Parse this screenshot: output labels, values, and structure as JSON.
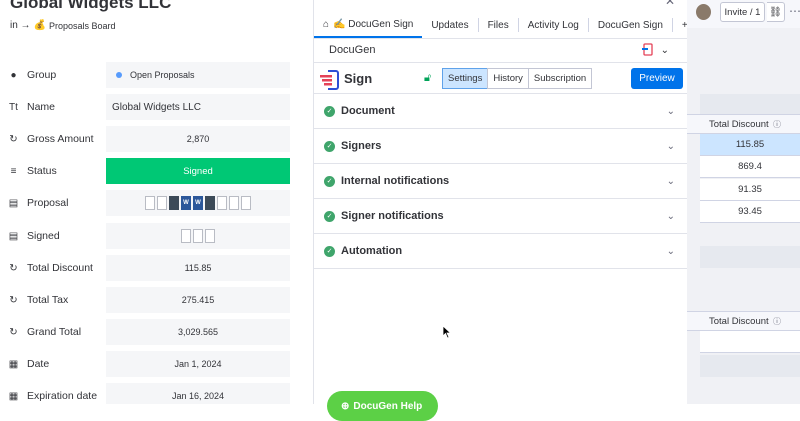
{
  "item": {
    "title": "Global Widgets LLC",
    "breadcrumb_prefix": "in →",
    "board_emoji": "💰",
    "board_name": "Proposals Board"
  },
  "columns": [
    {
      "icon": "●",
      "label": "Group",
      "value": "Open Proposals"
    },
    {
      "icon": "T",
      "label": "Name",
      "value": "Global Widgets LLC"
    },
    {
      "icon": "↻",
      "label": "Gross Amount",
      "value": "2,870"
    },
    {
      "icon": "≡",
      "label": "Status",
      "value": "Signed"
    },
    {
      "icon": "▤",
      "label": "Proposal",
      "value": ""
    },
    {
      "icon": "▤",
      "label": "Signed",
      "value": ""
    },
    {
      "icon": "↻",
      "label": "Total Discount",
      "value": "115.85"
    },
    {
      "icon": "↻",
      "label": "Total Tax",
      "value": "275.415"
    },
    {
      "icon": "↻",
      "label": "Grand Total",
      "value": "3,029.565"
    },
    {
      "icon": "▦",
      "label": "Date",
      "value": "Jan 1, 2024"
    },
    {
      "icon": "▦",
      "label": "Expiration date",
      "value": "Jan 16, 2024"
    }
  ],
  "panel": {
    "tabs": [
      "✍ DocuGen Sign",
      "Updates",
      "Files",
      "Activity Log",
      "DocuGen Sign",
      "+"
    ],
    "app_name": "DocuGen",
    "sign_title": "Sign",
    "buttons": [
      "Settings",
      "History",
      "Subscription"
    ],
    "preview": "Preview",
    "sections": [
      "Document",
      "Signers",
      "Internal notifications",
      "Signer notifications",
      "Automation"
    ],
    "help_label": "DocuGen Help"
  },
  "right": {
    "invite": "Invite / 1",
    "column_header": "Total Discount",
    "values": [
      "115.85",
      "869.4",
      "91.35",
      "93.45"
    ],
    "column_header_2": "Total Discount"
  },
  "colors": {
    "status_signed": "#00c875",
    "primary": "#0073ea",
    "check": "#3fa56b",
    "help": "#5cd046"
  }
}
